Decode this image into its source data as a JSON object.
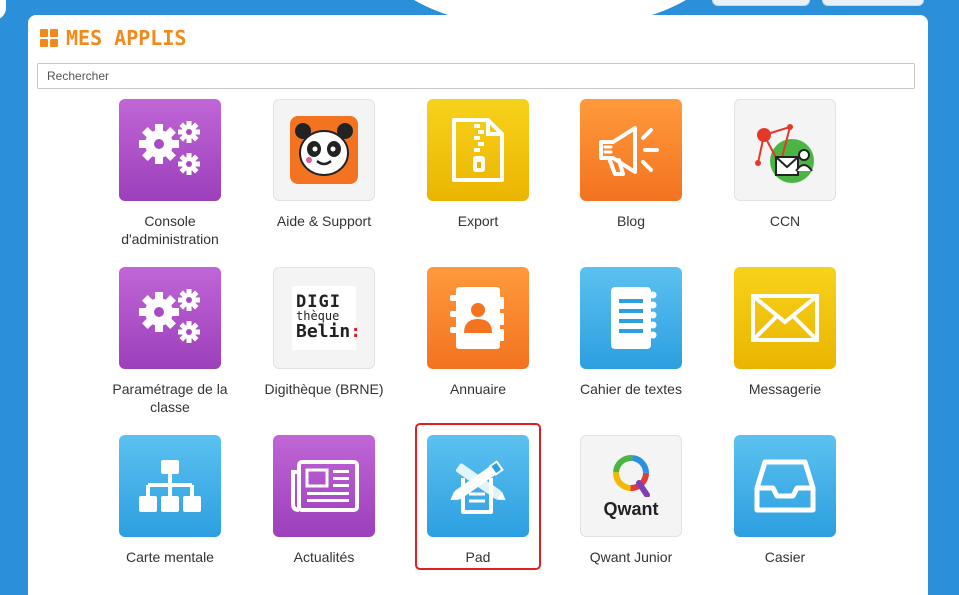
{
  "header": {
    "title": "MES APPLIS"
  },
  "search": {
    "placeholder": "Rechercher"
  },
  "apps": [
    {
      "label": "Console d'administration"
    },
    {
      "label": "Aide & Support"
    },
    {
      "label": "Export"
    },
    {
      "label": "Blog"
    },
    {
      "label": "CCN"
    },
    {
      "label": "Paramétrage de la classe"
    },
    {
      "label": "Digithèque (BRNE)"
    },
    {
      "label": "Annuaire"
    },
    {
      "label": "Cahier de textes"
    },
    {
      "label": "Messagerie"
    },
    {
      "label": "Carte mentale"
    },
    {
      "label": "Actualités"
    },
    {
      "label": "Pad"
    },
    {
      "label": "Qwant Junior"
    },
    {
      "label": "Casier"
    }
  ],
  "logos": {
    "digitheque": {
      "line1": "DIGI",
      "line2": "thèque",
      "line3": "Belin",
      "line3_mark": ":"
    },
    "qwant": {
      "word": "Qwant"
    }
  },
  "colors": {
    "accent": "#f08a1c",
    "purple": "#9c3fbb",
    "yellow": "#eab500",
    "orange": "#f37320",
    "blue": "#2c9fe0",
    "highlight": "#e02020"
  }
}
